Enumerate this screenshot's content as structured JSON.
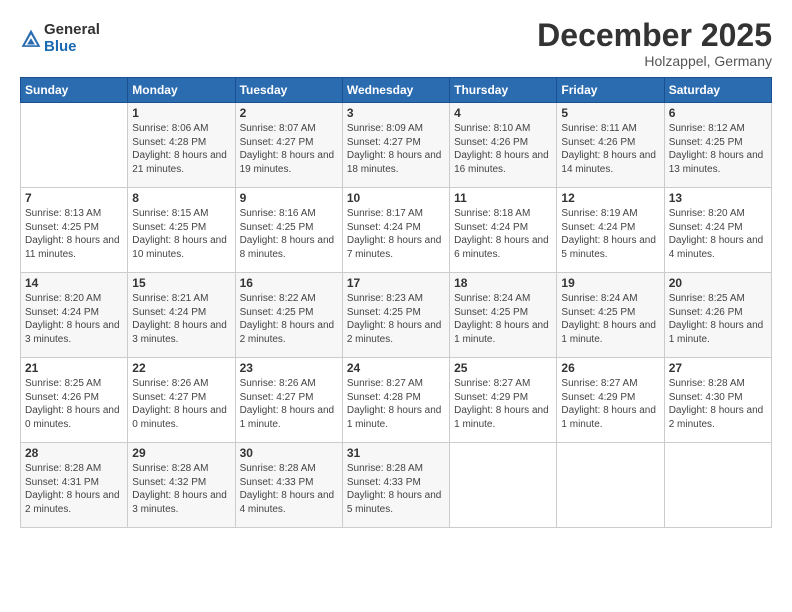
{
  "header": {
    "logo_general": "General",
    "logo_blue": "Blue",
    "month": "December 2025",
    "location": "Holzappel, Germany"
  },
  "days_of_week": [
    "Sunday",
    "Monday",
    "Tuesday",
    "Wednesday",
    "Thursday",
    "Friday",
    "Saturday"
  ],
  "weeks": [
    [
      {
        "day": "",
        "sunrise": "",
        "sunset": "",
        "daylight": ""
      },
      {
        "day": "1",
        "sunrise": "Sunrise: 8:06 AM",
        "sunset": "Sunset: 4:28 PM",
        "daylight": "Daylight: 8 hours and 21 minutes."
      },
      {
        "day": "2",
        "sunrise": "Sunrise: 8:07 AM",
        "sunset": "Sunset: 4:27 PM",
        "daylight": "Daylight: 8 hours and 19 minutes."
      },
      {
        "day": "3",
        "sunrise": "Sunrise: 8:09 AM",
        "sunset": "Sunset: 4:27 PM",
        "daylight": "Daylight: 8 hours and 18 minutes."
      },
      {
        "day": "4",
        "sunrise": "Sunrise: 8:10 AM",
        "sunset": "Sunset: 4:26 PM",
        "daylight": "Daylight: 8 hours and 16 minutes."
      },
      {
        "day": "5",
        "sunrise": "Sunrise: 8:11 AM",
        "sunset": "Sunset: 4:26 PM",
        "daylight": "Daylight: 8 hours and 14 minutes."
      },
      {
        "day": "6",
        "sunrise": "Sunrise: 8:12 AM",
        "sunset": "Sunset: 4:25 PM",
        "daylight": "Daylight: 8 hours and 13 minutes."
      }
    ],
    [
      {
        "day": "7",
        "sunrise": "Sunrise: 8:13 AM",
        "sunset": "Sunset: 4:25 PM",
        "daylight": "Daylight: 8 hours and 11 minutes."
      },
      {
        "day": "8",
        "sunrise": "Sunrise: 8:15 AM",
        "sunset": "Sunset: 4:25 PM",
        "daylight": "Daylight: 8 hours and 10 minutes."
      },
      {
        "day": "9",
        "sunrise": "Sunrise: 8:16 AM",
        "sunset": "Sunset: 4:25 PM",
        "daylight": "Daylight: 8 hours and 8 minutes."
      },
      {
        "day": "10",
        "sunrise": "Sunrise: 8:17 AM",
        "sunset": "Sunset: 4:24 PM",
        "daylight": "Daylight: 8 hours and 7 minutes."
      },
      {
        "day": "11",
        "sunrise": "Sunrise: 8:18 AM",
        "sunset": "Sunset: 4:24 PM",
        "daylight": "Daylight: 8 hours and 6 minutes."
      },
      {
        "day": "12",
        "sunrise": "Sunrise: 8:19 AM",
        "sunset": "Sunset: 4:24 PM",
        "daylight": "Daylight: 8 hours and 5 minutes."
      },
      {
        "day": "13",
        "sunrise": "Sunrise: 8:20 AM",
        "sunset": "Sunset: 4:24 PM",
        "daylight": "Daylight: 8 hours and 4 minutes."
      }
    ],
    [
      {
        "day": "14",
        "sunrise": "Sunrise: 8:20 AM",
        "sunset": "Sunset: 4:24 PM",
        "daylight": "Daylight: 8 hours and 3 minutes."
      },
      {
        "day": "15",
        "sunrise": "Sunrise: 8:21 AM",
        "sunset": "Sunset: 4:24 PM",
        "daylight": "Daylight: 8 hours and 3 minutes."
      },
      {
        "day": "16",
        "sunrise": "Sunrise: 8:22 AM",
        "sunset": "Sunset: 4:25 PM",
        "daylight": "Daylight: 8 hours and 2 minutes."
      },
      {
        "day": "17",
        "sunrise": "Sunrise: 8:23 AM",
        "sunset": "Sunset: 4:25 PM",
        "daylight": "Daylight: 8 hours and 2 minutes."
      },
      {
        "day": "18",
        "sunrise": "Sunrise: 8:24 AM",
        "sunset": "Sunset: 4:25 PM",
        "daylight": "Daylight: 8 hours and 1 minute."
      },
      {
        "day": "19",
        "sunrise": "Sunrise: 8:24 AM",
        "sunset": "Sunset: 4:25 PM",
        "daylight": "Daylight: 8 hours and 1 minute."
      },
      {
        "day": "20",
        "sunrise": "Sunrise: 8:25 AM",
        "sunset": "Sunset: 4:26 PM",
        "daylight": "Daylight: 8 hours and 1 minute."
      }
    ],
    [
      {
        "day": "21",
        "sunrise": "Sunrise: 8:25 AM",
        "sunset": "Sunset: 4:26 PM",
        "daylight": "Daylight: 8 hours and 0 minutes."
      },
      {
        "day": "22",
        "sunrise": "Sunrise: 8:26 AM",
        "sunset": "Sunset: 4:27 PM",
        "daylight": "Daylight: 8 hours and 0 minutes."
      },
      {
        "day": "23",
        "sunrise": "Sunrise: 8:26 AM",
        "sunset": "Sunset: 4:27 PM",
        "daylight": "Daylight: 8 hours and 1 minute."
      },
      {
        "day": "24",
        "sunrise": "Sunrise: 8:27 AM",
        "sunset": "Sunset: 4:28 PM",
        "daylight": "Daylight: 8 hours and 1 minute."
      },
      {
        "day": "25",
        "sunrise": "Sunrise: 8:27 AM",
        "sunset": "Sunset: 4:29 PM",
        "daylight": "Daylight: 8 hours and 1 minute."
      },
      {
        "day": "26",
        "sunrise": "Sunrise: 8:27 AM",
        "sunset": "Sunset: 4:29 PM",
        "daylight": "Daylight: 8 hours and 1 minute."
      },
      {
        "day": "27",
        "sunrise": "Sunrise: 8:28 AM",
        "sunset": "Sunset: 4:30 PM",
        "daylight": "Daylight: 8 hours and 2 minutes."
      }
    ],
    [
      {
        "day": "28",
        "sunrise": "Sunrise: 8:28 AM",
        "sunset": "Sunset: 4:31 PM",
        "daylight": "Daylight: 8 hours and 2 minutes."
      },
      {
        "day": "29",
        "sunrise": "Sunrise: 8:28 AM",
        "sunset": "Sunset: 4:32 PM",
        "daylight": "Daylight: 8 hours and 3 minutes."
      },
      {
        "day": "30",
        "sunrise": "Sunrise: 8:28 AM",
        "sunset": "Sunset: 4:33 PM",
        "daylight": "Daylight: 8 hours and 4 minutes."
      },
      {
        "day": "31",
        "sunrise": "Sunrise: 8:28 AM",
        "sunset": "Sunset: 4:33 PM",
        "daylight": "Daylight: 8 hours and 5 minutes."
      },
      {
        "day": "",
        "sunrise": "",
        "sunset": "",
        "daylight": ""
      },
      {
        "day": "",
        "sunrise": "",
        "sunset": "",
        "daylight": ""
      },
      {
        "day": "",
        "sunrise": "",
        "sunset": "",
        "daylight": ""
      }
    ]
  ]
}
